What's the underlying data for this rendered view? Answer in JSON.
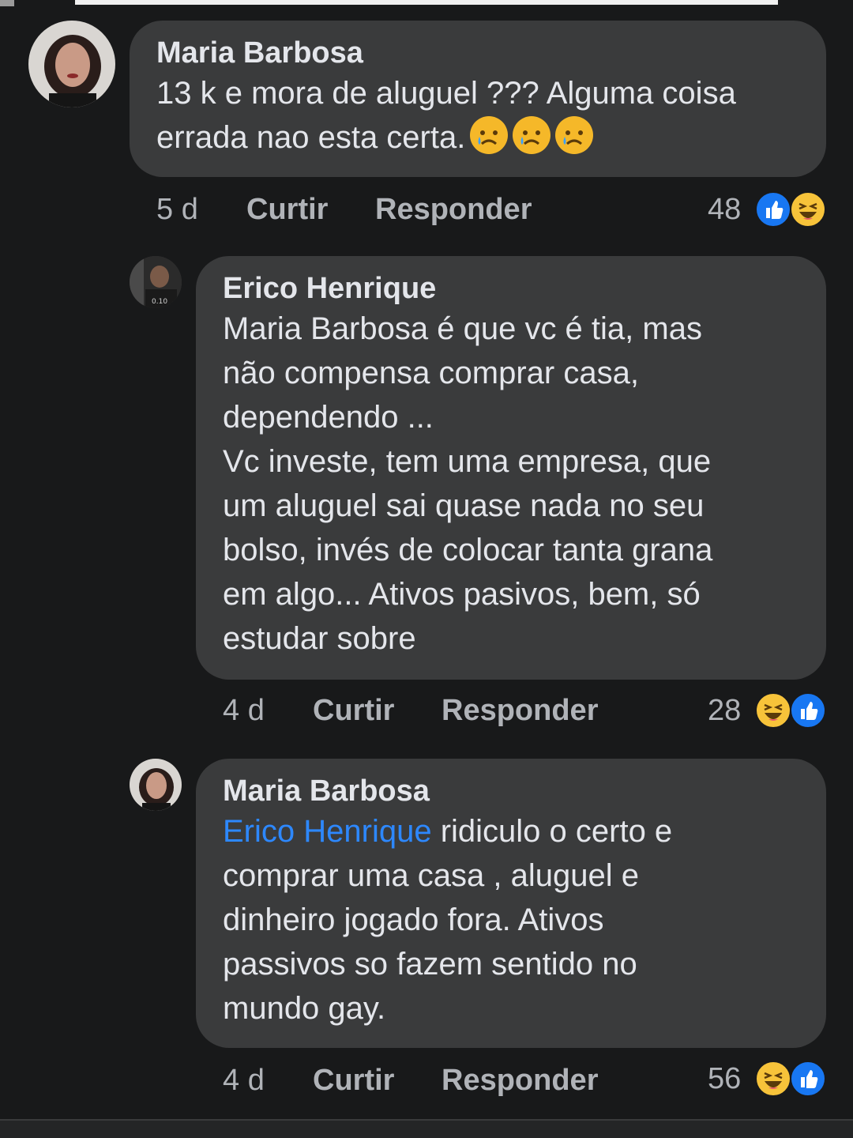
{
  "colors": {
    "background": "#18191a",
    "bubble": "#3a3b3c",
    "text": "#e4e6eb",
    "secondary_text": "#b0b3b8",
    "mention": "#2d88ff",
    "like": "#1877f2",
    "haha": "#f7c33a"
  },
  "comments": [
    {
      "author": "Maria Barbosa",
      "text": "13 k e mora de aluguel ??? Alguma coisa errada nao esta certa.",
      "emojis": [
        "sad-tear-emoji",
        "sad-tear-emoji",
        "sad-tear-emoji"
      ],
      "time": "5 d",
      "like_label": "Curtir",
      "reply_label": "Responder",
      "reaction_count": "48",
      "reactions": [
        "like-icon",
        "haha-icon"
      ]
    },
    {
      "author": "Erico Henrique",
      "text": "Maria Barbosa é que vc é tia, mas\nnão compensa comprar casa,\ndependendo ...\nVc investe, tem uma empresa, que\num aluguel sai quase nada no seu\nbolso, invés de colocar tanta grana\nem algo... Ativos pasivos, bem, só\nestudar sobre",
      "time": "4 d",
      "like_label": "Curtir",
      "reply_label": "Responder",
      "reaction_count": "28",
      "reactions": [
        "haha-icon",
        "like-icon"
      ]
    },
    {
      "author": "Maria Barbosa",
      "mention": "Erico Henrique",
      "text": " ridiculo o certo e\ncomprar uma casa , aluguel e\ndinheiro jogado fora. Ativos\npassivos so fazem sentido no\nmundo gay.",
      "time": "4 d",
      "like_label": "Curtir",
      "reply_label": "Responder",
      "reaction_count": "56",
      "reactions": [
        "haha-icon",
        "like-icon"
      ]
    }
  ]
}
